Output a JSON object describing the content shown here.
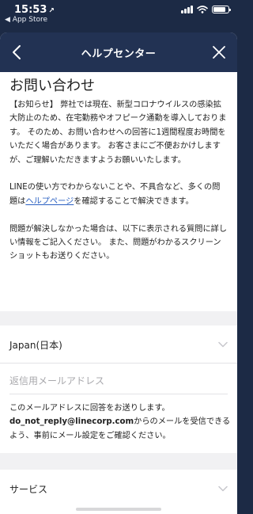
{
  "status_bar": {
    "time": "15:53",
    "location_glyph": "↗",
    "back_app": "◀ App Store",
    "battery_level": 0.85
  },
  "nav": {
    "title": "ヘルプセンター",
    "back_icon": "chevron-left-icon",
    "close_icon": "close-icon"
  },
  "page": {
    "title": "お問い合わせ",
    "notice_paragraphs": [
      "【お知らせ】 弊社では現在、新型コロナウイルスの感染拡大防止のため、在宅勤務やオフピーク通勤を導入しております。 そのため、お問い合わせへの回答に1週間程度お時間をいただく場合があります。 お客さまにご不便おかけしますが、ご理解いただきますようお願いいたします。"
    ],
    "help_prefix": "LINEの使い方でわからないことや、不具合など、多くの問題は",
    "help_link": "ヘルプページ",
    "help_suffix": "を確認することで解決できます。",
    "detail_text": "問題が解決しなかった場合は、以下に表示される質問に詳しい情報をご記入ください。 また、問題がわかるスクリーンショットもお送りください。"
  },
  "form": {
    "country": "Japan(日本)",
    "email_placeholder": "返信用メールアドレス",
    "email_note_1": "このメールアドレスに回答をお送りします。",
    "email_sender": "do_not_reply@linecorp.com",
    "email_note_2": "からのメールを受信できるよう、事前にメール設定をご確認ください。",
    "service_label": "サービス"
  },
  "colors": {
    "nav_bg": "#223253",
    "link": "#2a60c2"
  }
}
